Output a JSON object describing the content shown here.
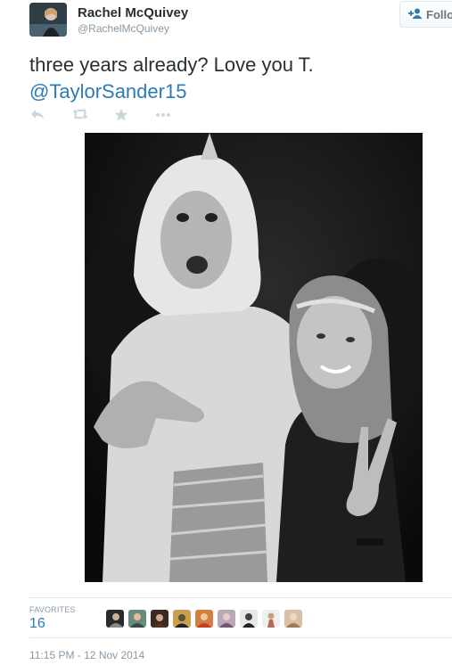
{
  "user": {
    "name": "Rachel McQuivey",
    "handle": "@RachelMcQuivey",
    "follow_label": "Follow"
  },
  "tweet": {
    "text": "three years already? Love you T.",
    "mention": "@TaylorSander15",
    "actions": [
      {
        "icon": "reply-icon"
      },
      {
        "icon": "retweet-icon"
      },
      {
        "icon": "favorite-star-icon"
      },
      {
        "icon": "more-dots-icon"
      }
    ]
  },
  "stats": {
    "favorites_label": "FAVORITES",
    "favorites_count": "16",
    "favoriters_count": 9
  },
  "timestamp": "11:15 PM - 12 Nov 2014",
  "colors": {
    "link": "#2b7bb9",
    "text": "#292f33",
    "muted": "#8899a6",
    "icon": "#ccd6dd"
  }
}
